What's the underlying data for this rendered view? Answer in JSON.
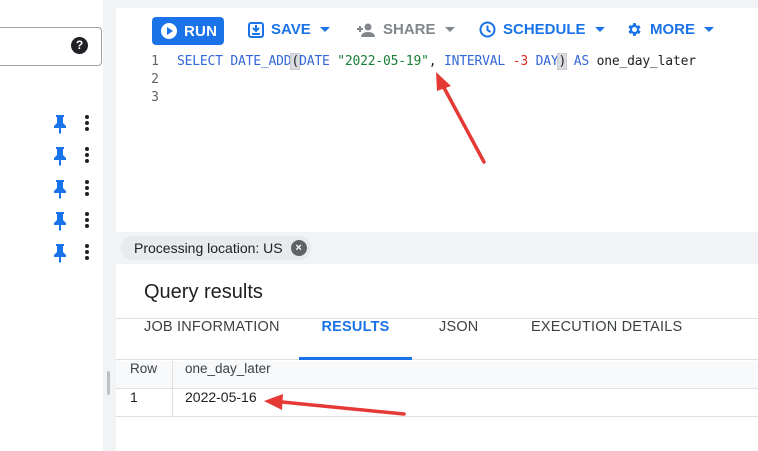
{
  "toolbar": {
    "run_label": "RUN",
    "save_label": "SAVE",
    "share_label": "SHARE",
    "schedule_label": "SCHEDULE",
    "more_label": "MORE"
  },
  "left_panel": {
    "help_label": "?",
    "row_count": 5
  },
  "editor": {
    "line_numbers": [
      "1",
      "2",
      "3"
    ],
    "tokens": {
      "select": "SELECT",
      "func": "DATE_ADD",
      "open_paren": "(",
      "date_kw": "DATE",
      "date_literal": "\"2022-05-19\"",
      "comma": ",",
      "interval_kw": "INTERVAL",
      "interval_value": "-3",
      "day_kw": "DAY",
      "close_paren": ")",
      "as_kw": "AS",
      "alias": "one_day_later"
    }
  },
  "processing": {
    "label": "Processing location: US",
    "close_glyph": "×"
  },
  "results": {
    "title": "Query results",
    "tabs": [
      {
        "label": "JOB INFORMATION",
        "active": false
      },
      {
        "label": "RESULTS",
        "active": true
      },
      {
        "label": "JSON",
        "active": false
      },
      {
        "label": "EXECUTION DETAILS",
        "active": false
      }
    ],
    "columns": [
      "Row",
      "one_day_later"
    ],
    "rows": [
      [
        "1",
        "2022-05-16"
      ]
    ]
  },
  "colors": {
    "accent": "#1a73e8",
    "annotation_arrow": "#e53935"
  }
}
